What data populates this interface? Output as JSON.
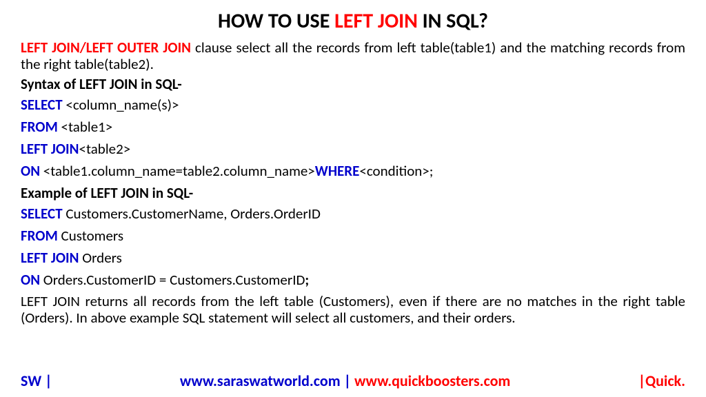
{
  "title": {
    "part1": "HOW TO USE ",
    "highlight": "LEFT JOIN",
    "part2": " IN SQL?"
  },
  "intro": {
    "bold": "LEFT JOIN/LEFT OUTER JOIN",
    "text": " clause select all the records from left table(table1) and the matching records from the right table(table2)."
  },
  "syntax_heading": "Syntax of LEFT JOIN in SQL-",
  "syntax": {
    "line1_kw": "SELECT",
    "line1_rest": " <column_name(s)>",
    "line2_kw": "FROM",
    "line2_rest": " <table1>",
    "line3_kw": "LEFT JOIN",
    "line3_rest": "<table2>",
    "line4_kw": "ON",
    "line4_rest": " <table1.column_name=table2.column_name>",
    "line4_kw2": "WHERE",
    "line4_rest2": "<condition>;"
  },
  "example_heading": "Example of LEFT JOIN in SQL-",
  "example": {
    "line1_kw": "SELECT",
    "line1_rest": " Customers.CustomerName, Orders.OrderID",
    "line2_kw": "FROM",
    "line2_rest": " Customers",
    "line3_kw": "LEFT JOIN",
    "line3_rest": " Orders",
    "line4_kw": "ON",
    "line4_rest": " Orders.CustomerID = Customers.CustomerID",
    "line4_semi": ";"
  },
  "explanation": "LEFT JOIN returns all records from the left table (Customers), even if there are no matches in the right table (Orders). In above example SQL statement will select all customers, and their orders.",
  "footer": {
    "left": "SW |",
    "center_blue": "www.saraswatworld.com | ",
    "center_red": "www.quickboosters.com",
    "right": "|Quick."
  }
}
